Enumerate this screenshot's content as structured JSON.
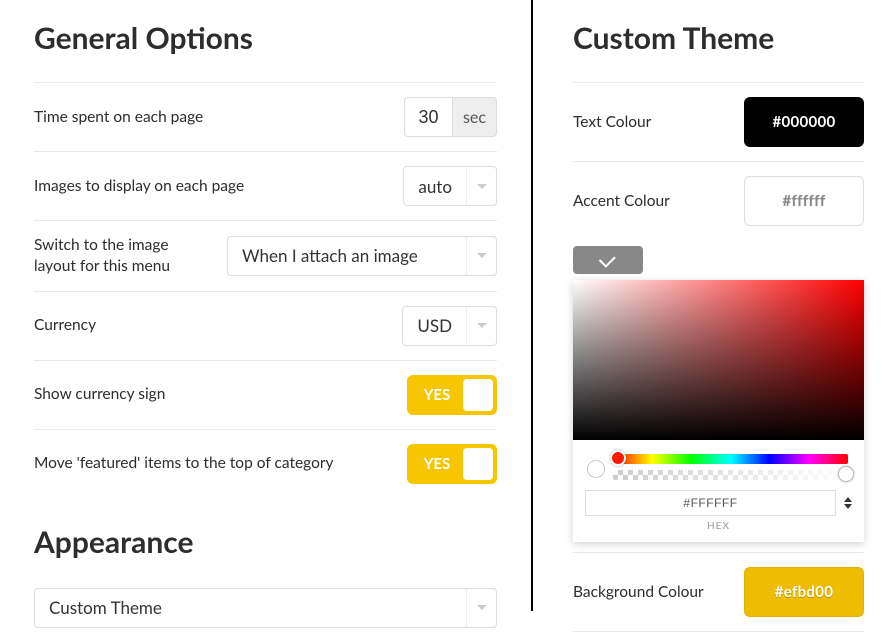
{
  "general": {
    "heading": "General Options",
    "time_label": "Time spent on each page",
    "time_value": "30",
    "time_suffix": "sec",
    "images_label": "Images to display on each page",
    "images_value": "auto",
    "switch_label": "Switch to the image layout for this menu",
    "switch_value": "When I attach an image",
    "currency_label": "Currency",
    "currency_value": "USD",
    "show_sign_label": "Show currency sign",
    "show_sign_value": "YES",
    "featured_label": "Move 'featured' items to the top of category",
    "featured_value": "YES"
  },
  "appearance": {
    "heading": "Appearance",
    "theme_value": "Custom Theme"
  },
  "theme": {
    "heading": "Custom Theme",
    "text_colour_label": "Text Colour",
    "text_colour_value": "#000000",
    "accent_colour_label": "Accent Colour",
    "accent_colour_value": "#ffffff",
    "bg_colour_label": "Background Colour",
    "bg_colour_value": "#efbd00",
    "picker_hex": "#FFFFFF",
    "picker_format": "HEX"
  }
}
